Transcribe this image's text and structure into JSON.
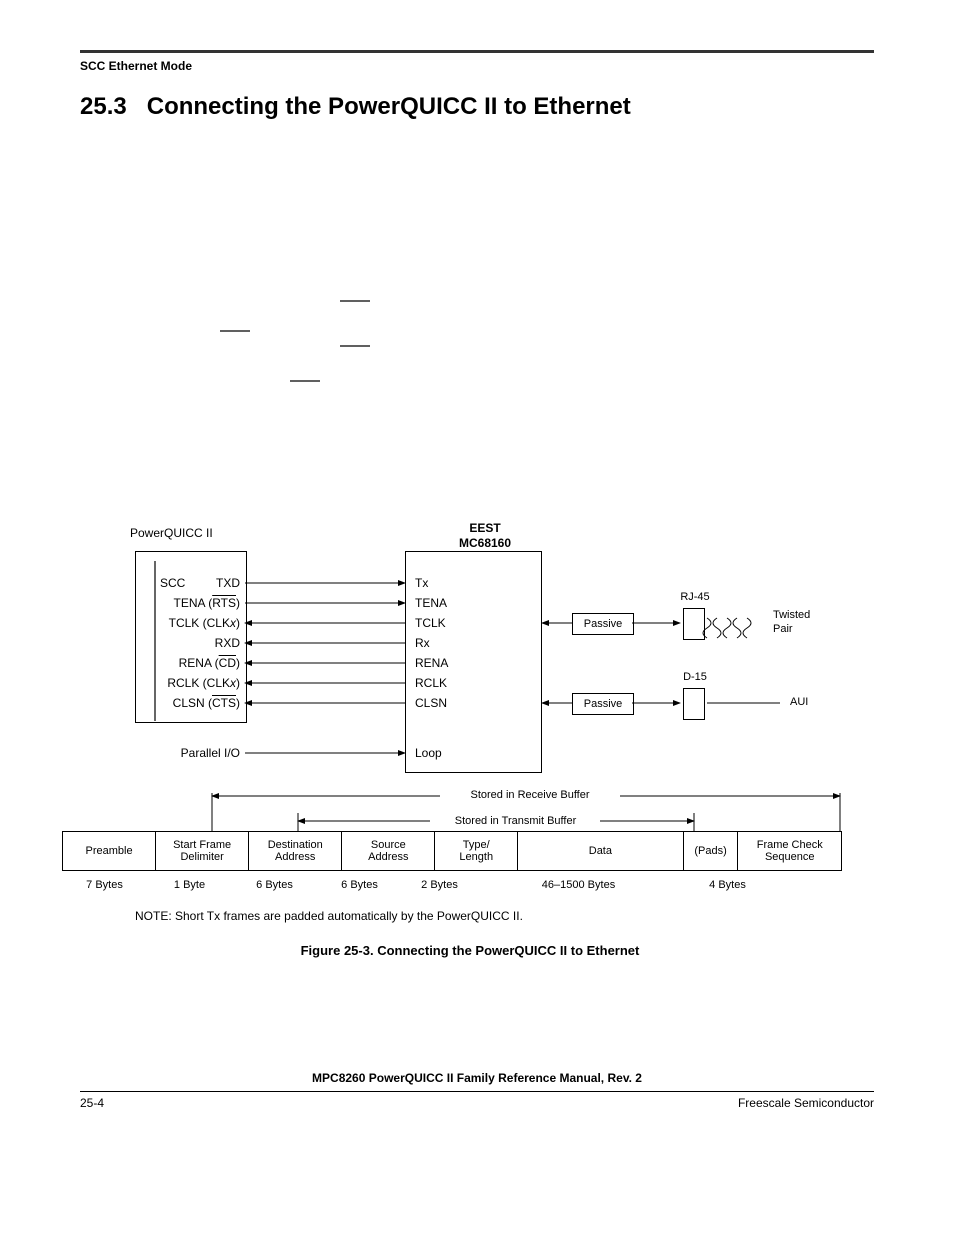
{
  "header": {
    "running_head": "SCC Ethernet Mode",
    "section_number": "25.3",
    "section_title": "Connecting the PowerQUICC II to Ethernet"
  },
  "diagram": {
    "block_left_title": "PowerQUICC II",
    "block_left_sub": "SCC",
    "block_right_title_line1": "EEST",
    "block_right_title_line2": "MC68160",
    "left_signals": {
      "txd": "TXD",
      "tena_rts_pre": "TENA (",
      "tena_rts_over": "RTS",
      "tena_rts_post": ")",
      "tclk_pre": "TCLK (CLK",
      "tclk_ital": "x",
      "tclk_post": ")",
      "rxd": "RXD",
      "rena_cd_pre": "RENA (",
      "rena_cd_over": "CD",
      "rena_cd_post": ")",
      "rclk_pre": "RCLK (CLK",
      "rclk_ital": "x",
      "rclk_post": ")",
      "clsn_cts_pre": "CLSN (",
      "clsn_cts_over": "CTS",
      "clsn_cts_post": ")",
      "parallel_io": "Parallel I/O"
    },
    "right_signals": {
      "tx": "Tx",
      "tena": "TENA",
      "tclk": "TCLK",
      "rx": "Rx",
      "rena": "RENA",
      "rclk": "RCLK",
      "clsn": "CLSN",
      "loop": "Loop"
    },
    "passive1": "Passive",
    "passive2": "Passive",
    "rj45": "RJ-45",
    "twisted": "Twisted",
    "pair": "Pair",
    "d15": "D-15",
    "aui": "AUI",
    "stored_rx": "Stored in Receive Buffer",
    "stored_tx": "Stored in Transmit Buffer",
    "frame": {
      "preamble": "Preamble",
      "sfd_l1": "Start Frame",
      "sfd_l2": "Delimiter",
      "dest_l1": "Destination",
      "dest_l2": "Address",
      "src_l1": "Source",
      "src_l2": "Address",
      "type_l1": "Type/",
      "type_l2": "Length",
      "data": "Data",
      "pads": "(Pads)",
      "fcs_l1": "Frame Check",
      "fcs_l2": "Sequence"
    },
    "sizes": {
      "s1": "7 Bytes",
      "s2": "1 Byte",
      "s3": "6 Bytes",
      "s4": "6 Bytes",
      "s5": "2 Bytes",
      "s6": "46–1500 Bytes",
      "s7": "4 Bytes"
    },
    "note_text": "NOTE: Short Tx frames are padded automatically by the PowerQUICC II.",
    "caption": "Figure 25-3. Connecting the PowerQUICC II to Ethernet"
  },
  "footer": {
    "manual": "MPC8260 PowerQUICC II Family Reference Manual, Rev. 2",
    "page": "25-4",
    "vendor": "Freescale Semiconductor"
  }
}
